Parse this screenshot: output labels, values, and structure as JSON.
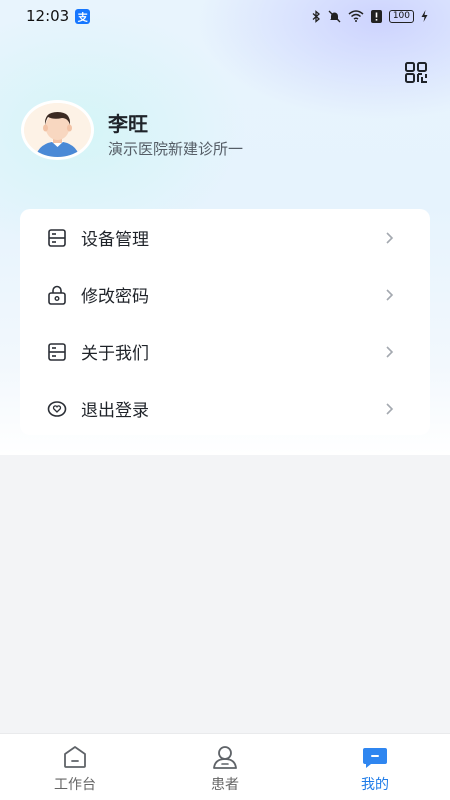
{
  "status_bar": {
    "time": "12:03",
    "alipay_badge": "支",
    "battery": "100"
  },
  "profile": {
    "name": "李旺",
    "organization": "演示医院新建诊所一"
  },
  "menu": {
    "items": [
      {
        "label": "设备管理",
        "icon": "device-icon"
      },
      {
        "label": "修改密码",
        "icon": "lock-icon"
      },
      {
        "label": "关于我们",
        "icon": "info-card-icon"
      },
      {
        "label": "退出登录",
        "icon": "logout-heart-icon"
      }
    ]
  },
  "bottom_nav": {
    "tabs": [
      {
        "label": "工作台",
        "icon": "home-icon",
        "active": false
      },
      {
        "label": "患者",
        "icon": "person-icon",
        "active": false
      },
      {
        "label": "我的",
        "icon": "chat-bubble-icon",
        "active": true
      }
    ]
  },
  "colors": {
    "accent": "#1e7be8",
    "background": "#f3f4f6",
    "card": "#ffffff"
  }
}
